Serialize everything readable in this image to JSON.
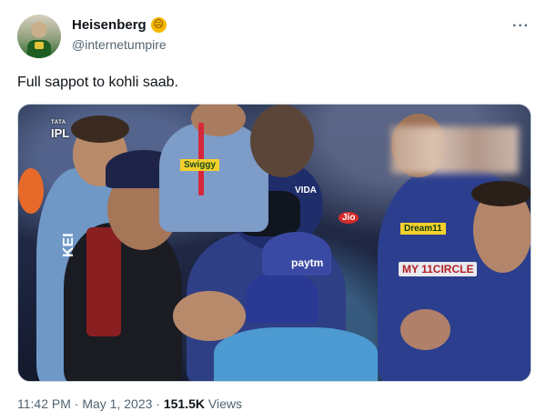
{
  "author": {
    "display_name": "Heisenberg",
    "badge_emoji": "☹",
    "handle": "@internetumpire"
  },
  "tweet": {
    "text": "Full sappot to kohli saab."
  },
  "media": {
    "watermark_small": "TATA",
    "watermark": "IPL",
    "sponsors": {
      "sponsor_1": "Dream11",
      "sponsor_2": "VIDA",
      "sponsor_3": "paytm",
      "sponsor_4": "MY 11CIRCLE",
      "sponsor_5": "Jio",
      "sponsor_6": "KEI",
      "sponsor_7": "Swiggy"
    }
  },
  "meta": {
    "time": "11:42 PM",
    "sep": "·",
    "date": "May 1, 2023",
    "views_count": "151.5K",
    "views_label": "Views"
  },
  "colors": {
    "accent_badge": "#f5b800",
    "text_primary": "#0f1419",
    "text_secondary": "#536471"
  },
  "icons": {
    "more": "more-horizontal-icon"
  }
}
